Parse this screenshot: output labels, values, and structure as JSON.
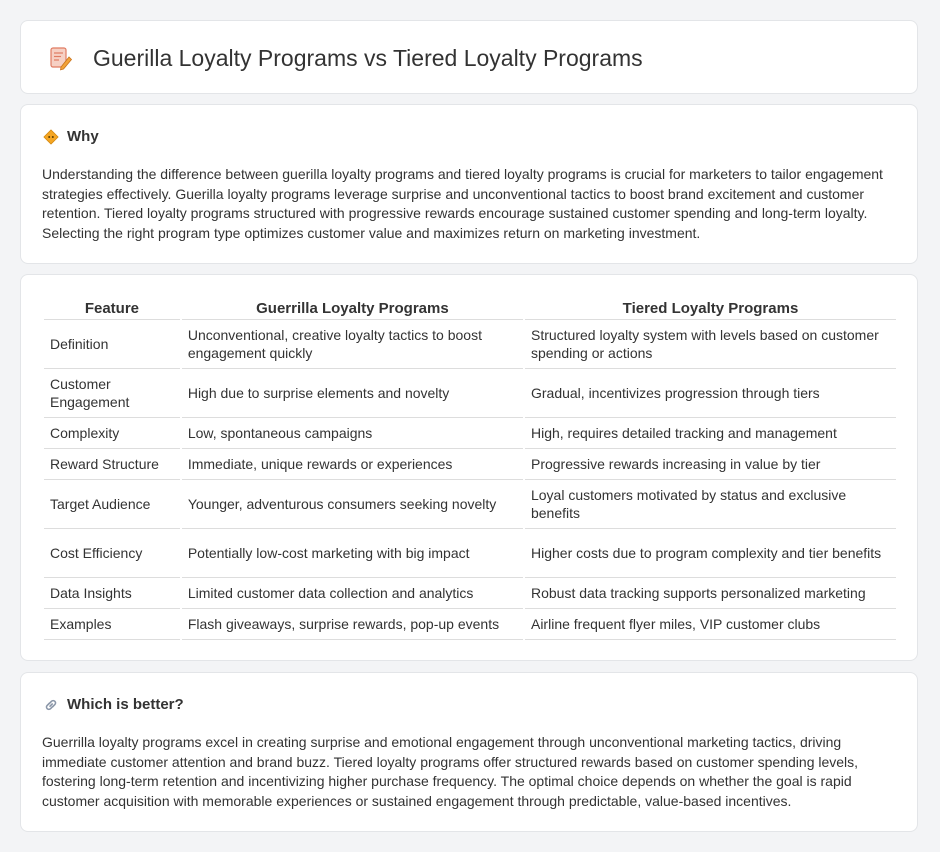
{
  "page": {
    "title": "Guerilla Loyalty Programs vs Tiered Loyalty Programs",
    "title_icon": "document-pencil-icon"
  },
  "why": {
    "icon": "diamond-sign-icon",
    "heading": "Why",
    "text": "Understanding the difference between guerilla loyalty programs and tiered loyalty programs is crucial for marketers to tailor engagement strategies effectively. Guerilla loyalty programs leverage surprise and unconventional tactics to boost brand excitement and customer retention. Tiered loyalty programs structured with progressive rewards encourage sustained customer spending and long-term loyalty. Selecting the right program type optimizes customer value and maximizes return on marketing investment."
  },
  "comparison": {
    "headers": [
      "Feature",
      "Guerrilla Loyalty Programs",
      "Tiered Loyalty Programs"
    ],
    "rows": [
      [
        "Definition",
        "Unconventional, creative loyalty tactics to boost engagement quickly",
        "Structured loyalty system with levels based on customer spending or actions"
      ],
      [
        "Customer Engagement",
        "High due to surprise elements and novelty",
        "Gradual, incentivizes progression through tiers"
      ],
      [
        "Complexity",
        "Low, spontaneous campaigns",
        "High, requires detailed tracking and management"
      ],
      [
        "Reward Structure",
        "Immediate, unique rewards or experiences",
        "Progressive rewards increasing in value by tier"
      ],
      [
        "Target Audience",
        "Younger, adventurous consumers seeking novelty",
        "Loyal customers motivated by status and exclusive benefits"
      ],
      [
        "Cost Efficiency",
        "Potentially low-cost marketing with big impact",
        "Higher costs due to program complexity and tier benefits"
      ],
      [
        "Data Insights",
        "Limited customer data collection and analytics",
        "Robust data tracking supports personalized marketing"
      ],
      [
        "Examples",
        "Flash giveaways, surprise rewards, pop-up events",
        "Airline frequent flyer miles, VIP customer clubs"
      ]
    ]
  },
  "better": {
    "icon": "link-icon",
    "heading": "Which is better?",
    "text": "Guerrilla loyalty programs excel in creating surprise and emotional engagement through unconventional marketing tactics, driving immediate customer attention and brand buzz. Tiered loyalty programs offer structured rewards based on customer spending levels, fostering long-term retention and incentivizing higher purchase frequency. The optimal choice depends on whether the goal is rapid customer acquisition with memorable experiences or sustained engagement through predictable, value-based incentives."
  }
}
